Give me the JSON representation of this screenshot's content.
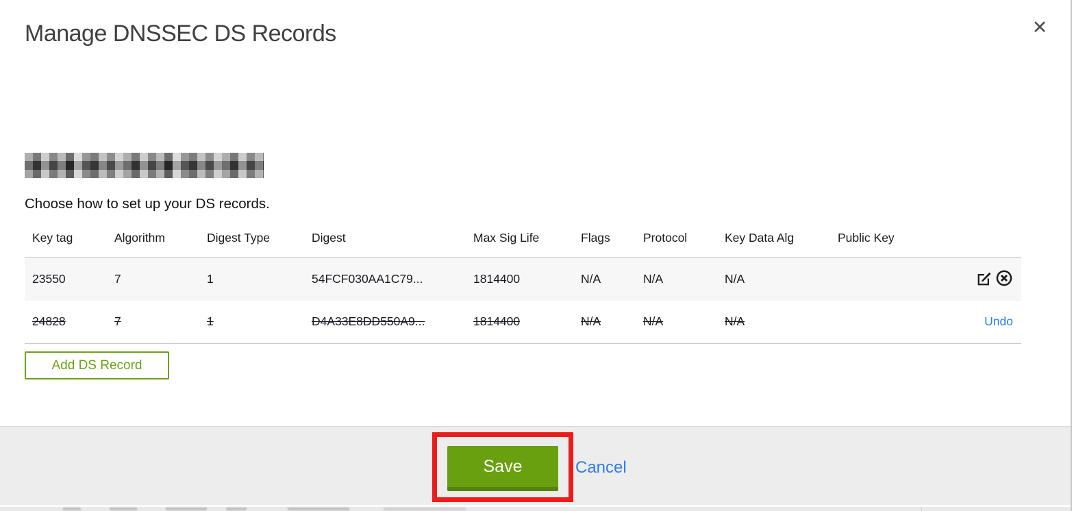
{
  "window": {
    "close_icon_glyph": "✕"
  },
  "modal": {
    "title": "Manage DNSSEC DS Records",
    "domain_redacted": true,
    "instruction": "Choose how to set up your DS records."
  },
  "table": {
    "columns": [
      "Key tag",
      "Algorithm",
      "Digest Type",
      "Digest",
      "Max Sig Life",
      "Flags",
      "Protocol",
      "Key Data Alg",
      "Public Key"
    ],
    "rows": [
      {
        "key_tag": "23550",
        "algorithm": "7",
        "digest_type": "1",
        "digest": "54FCF030AA1C79...",
        "max_sig_life": "1814400",
        "flags": "N/A",
        "protocol": "N/A",
        "key_data_alg": "N/A",
        "public_key": "",
        "state": "active",
        "action_icons": [
          "edit-icon",
          "delete-circle-icon"
        ]
      },
      {
        "key_tag": "24828",
        "algorithm": "7",
        "digest_type": "1",
        "digest": "D4A33E8DD550A9...",
        "max_sig_life": "1814400",
        "flags": "N/A",
        "protocol": "N/A",
        "key_data_alg": "N/A",
        "public_key": "",
        "state": "marked-for-deletion",
        "undo_label": "Undo"
      }
    ]
  },
  "actions": {
    "add_ds_record_label": "Add DS Record",
    "save_label": "Save",
    "cancel_label": "Cancel"
  },
  "annotation": {
    "type": "highlight-rectangle",
    "color": "#ed1c1c",
    "highlights": "save-button"
  },
  "colors": {
    "accent_green": "#6da211",
    "save_green": "#69a00f",
    "save_green_dark": "#56830b",
    "link_blue": "#2e7cf2",
    "footer_gray": "#ededed",
    "row_shade": "#f7f7f7",
    "border_gray": "#cccccc",
    "text_dark": "#16191f"
  }
}
